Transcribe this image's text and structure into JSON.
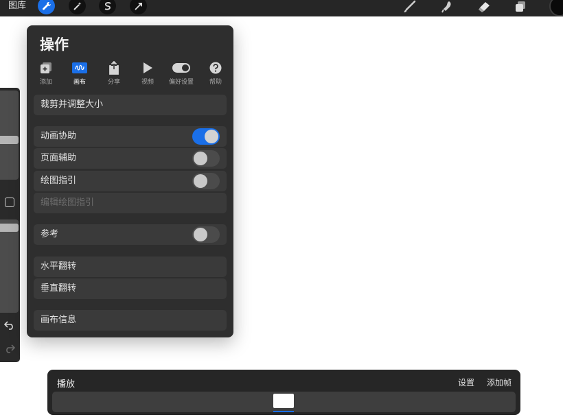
{
  "topbar": {
    "gallery_label": "图库",
    "tools_left": [
      "wrench-icon",
      "magic-wand-icon",
      "selection-s-icon",
      "move-arrow-icon"
    ],
    "tools_right": [
      "brush-icon",
      "smudge-icon",
      "eraser-icon",
      "layers-icon"
    ],
    "active_color": "#0a0a0a"
  },
  "actions_panel": {
    "title": "操作",
    "tabs": [
      {
        "label": "添加",
        "icon": "add-icon"
      },
      {
        "label": "画布",
        "icon": "canvas-icon",
        "active": true
      },
      {
        "label": "分享",
        "icon": "share-icon"
      },
      {
        "label": "视频",
        "icon": "video-play-icon"
      },
      {
        "label": "偏好设置",
        "icon": "preferences-toggle-icon"
      },
      {
        "label": "帮助",
        "icon": "help-icon"
      }
    ],
    "items": {
      "crop_resize": "裁剪并调整大小",
      "animation_assist": {
        "label": "动画协助",
        "on": true
      },
      "page_assist": {
        "label": "页面辅助",
        "on": false
      },
      "drawing_guide": {
        "label": "绘图指引",
        "on": false
      },
      "edit_drawing_guide": "编辑绘图指引",
      "reference": {
        "label": "参考",
        "on": false
      },
      "flip_horizontal": "水平翻转",
      "flip_vertical": "垂直翻转",
      "canvas_info": "画布信息"
    }
  },
  "timeline": {
    "title": "播放",
    "settings_label": "设置",
    "add_frame_label": "添加帧"
  },
  "colors": {
    "accent": "#1a6fe8",
    "panel_bg": "#2e2e2e",
    "row_bg": "#3a3a3a"
  }
}
